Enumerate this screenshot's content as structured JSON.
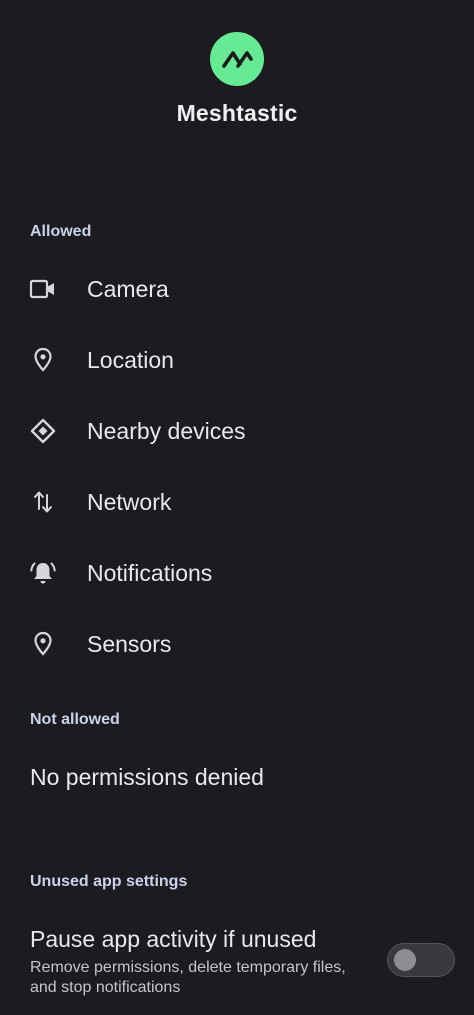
{
  "app": {
    "name": "Meshtastic",
    "icon": "meshtastic-logo-icon",
    "icon_bg_color": "#67ea94"
  },
  "sections": {
    "allowed": {
      "header": "Allowed",
      "items": [
        {
          "label": "Camera",
          "icon": "camera-icon"
        },
        {
          "label": "Location",
          "icon": "location-pin-icon"
        },
        {
          "label": "Nearby devices",
          "icon": "nearby-devices-icon"
        },
        {
          "label": "Network",
          "icon": "network-arrows-icon"
        },
        {
          "label": "Notifications",
          "icon": "bell-icon"
        },
        {
          "label": "Sensors",
          "icon": "sensors-icon"
        }
      ]
    },
    "not_allowed": {
      "header": "Not allowed",
      "empty_text": "No permissions denied"
    },
    "unused_app_settings": {
      "header": "Unused app settings",
      "pause_activity": {
        "title": "Pause app activity if unused",
        "description": "Remove permissions, delete temporary files, and stop notifications",
        "enabled": false
      }
    }
  },
  "colors": {
    "background": "#1c1b1f",
    "section_header": "#c9d4ec",
    "text": "#ece7ec"
  }
}
